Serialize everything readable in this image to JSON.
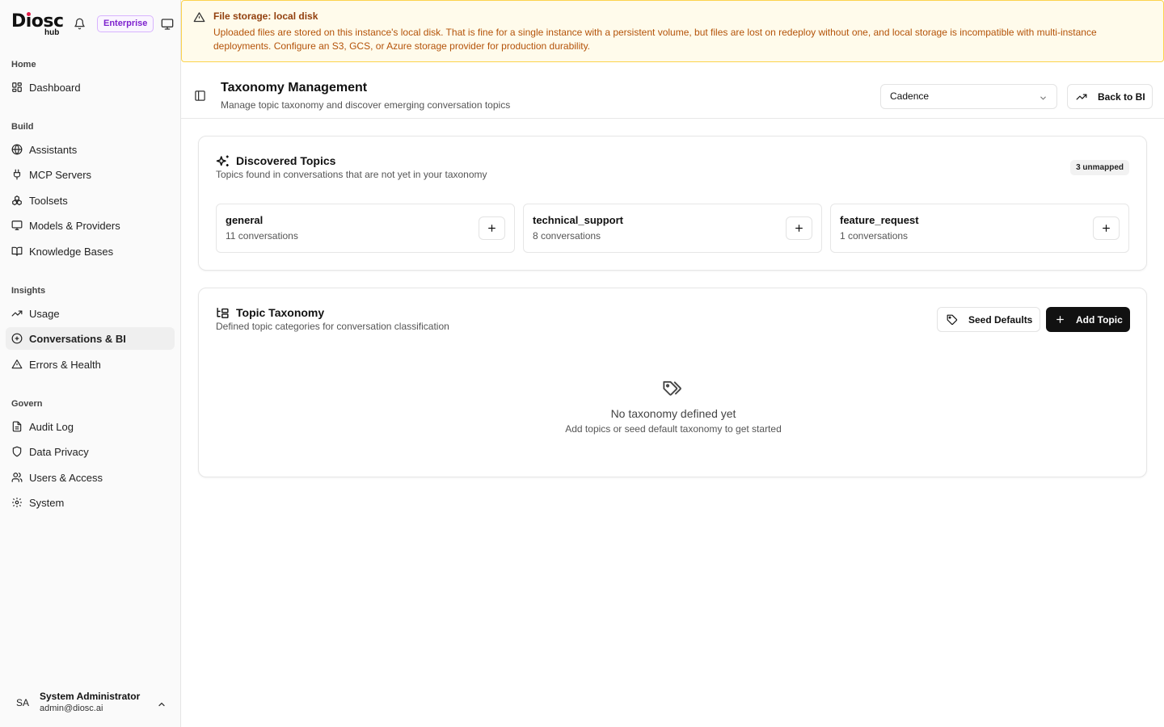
{
  "app": {
    "logo": "Diosc",
    "logo_sub": "hub",
    "edition_badge": "Enterprise",
    "brand_dot_color": "#e11d48",
    "badge_color": "#7e22ce"
  },
  "sidebar": {
    "sections": {
      "home": "Home",
      "build": "Build",
      "insights": "Insights",
      "govern": "Govern"
    },
    "items": {
      "dashboard": "Dashboard",
      "assistants": "Assistants",
      "mcp_servers": "MCP Servers",
      "toolsets": "Toolsets",
      "models": "Models & Providers",
      "knowledge": "Knowledge Bases",
      "usage": "Usage",
      "conversations": "Conversations & BI",
      "errors": "Errors & Health",
      "audit": "Audit Log",
      "privacy": "Data Privacy",
      "users": "Users & Access",
      "system": "System"
    },
    "active_item": "conversations",
    "user": {
      "initials": "SA",
      "name": "System Administrator",
      "email": "admin@diosc.ai"
    }
  },
  "alert": {
    "title": "File storage: local disk",
    "body": "Uploaded files are stored on this instance's local disk. That is fine for a single instance with a persistent volume, but files are lost on redeploy without one, and local storage is incompatible with multi-instance deployments. Configure an S3, GCS, or Azure storage provider for production durability.",
    "accent_color": "#b45309"
  },
  "header": {
    "title": "Taxonomy Management",
    "subtitle": "Manage topic taxonomy and discover emerging conversation topics",
    "assistant_select": "Cadence",
    "back_label": "Back to BI"
  },
  "discovered": {
    "title": "Discovered Topics",
    "subtitle": "Topics found in conversations that are not yet in your taxonomy",
    "badge": "3 unmapped",
    "topics": [
      {
        "name": "general",
        "count": "11 conversations"
      },
      {
        "name": "technical_support",
        "count": "8 conversations"
      },
      {
        "name": "feature_request",
        "count": "1 conversations"
      }
    ]
  },
  "taxonomy": {
    "title": "Topic Taxonomy",
    "subtitle": "Defined topic categories for conversation classification",
    "seed_label": "Seed Defaults",
    "add_label": "Add Topic",
    "empty_title": "No taxonomy defined yet",
    "empty_sub": "Add topics or seed default taxonomy to get started"
  }
}
